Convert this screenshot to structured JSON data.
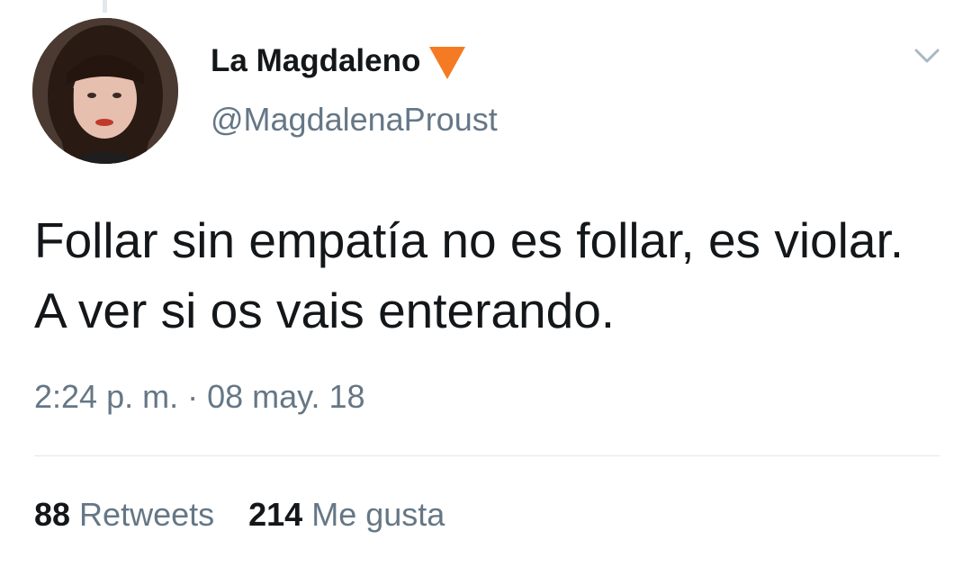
{
  "tweet": {
    "author": {
      "display_name": "La Magdaleno",
      "handle": "@MagdalenaProust",
      "badge_icon": "orange-triangle-icon",
      "badge_color": "#f47b24"
    },
    "text": "Follar sin empatía no es follar, es violar. A ver si os vais enterando.",
    "timestamp": "2:24 p. m. · 08 may. 18",
    "stats": {
      "retweets_count": "88",
      "retweets_label": "Retweets",
      "likes_count": "214",
      "likes_label": "Me gusta"
    },
    "menu_icon": "chevron-down-icon"
  },
  "colors": {
    "primary_text": "#14171a",
    "secondary_text": "#657786",
    "divider": "#e1e8ed"
  }
}
